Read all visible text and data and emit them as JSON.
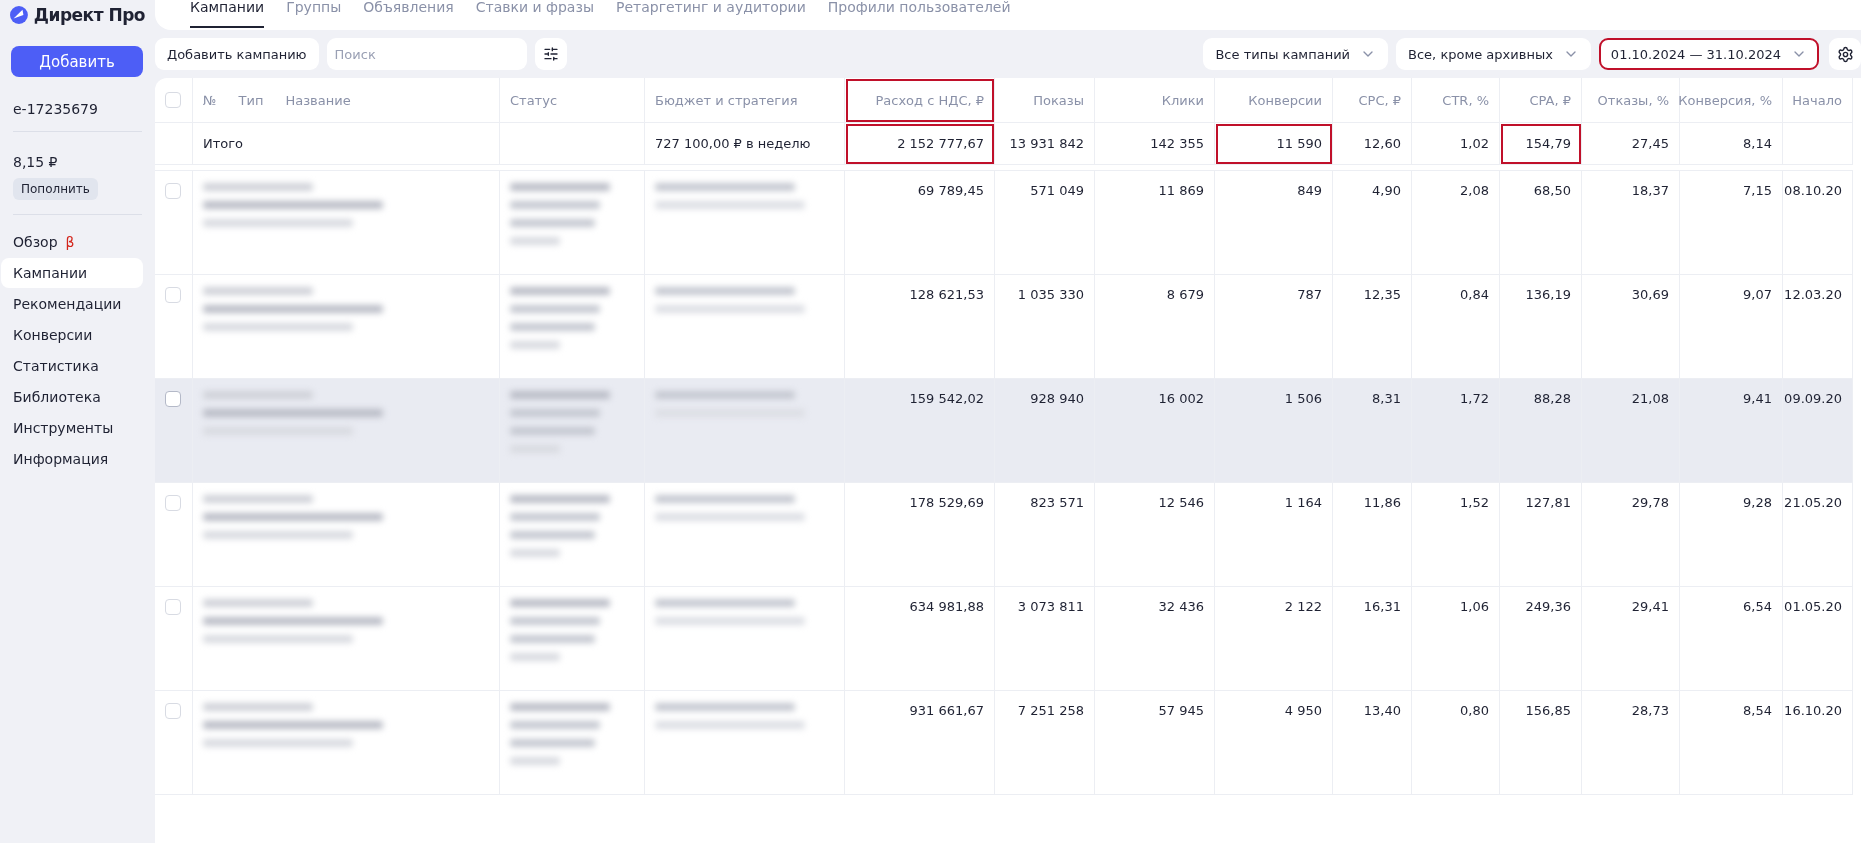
{
  "sidebar": {
    "logo": "Директ Про",
    "add_button": "Добавить",
    "account": "e-17235679",
    "balance": "8,15 ₽",
    "topup_button": "Пополнить",
    "nav": [
      {
        "label": "Обзор",
        "badge": "β",
        "selected": false
      },
      {
        "label": "Кампании",
        "selected": true
      },
      {
        "label": "Рекомендации",
        "selected": false
      },
      {
        "label": "Конверсии",
        "selected": false
      },
      {
        "label": "Статистика",
        "selected": false
      },
      {
        "label": "Библиотека",
        "selected": false
      },
      {
        "label": "Инструменты",
        "selected": false
      },
      {
        "label": "Информация",
        "selected": false
      }
    ]
  },
  "tabs": [
    {
      "label": "Кампании",
      "selected": true
    },
    {
      "label": "Группы",
      "selected": false
    },
    {
      "label": "Объявления",
      "selected": false
    },
    {
      "label": "Ставки и фразы",
      "selected": false
    },
    {
      "label": "Ретаргетинг и аудитории",
      "selected": false
    },
    {
      "label": "Профили пользователей",
      "selected": false
    }
  ],
  "toolbar": {
    "add_campaign": "Добавить кампанию",
    "search": {
      "placeholder": "Поиск"
    },
    "filters": [
      {
        "label": "Все типы кампаний",
        "highlighted": false
      },
      {
        "label": "Все, кроме архивных",
        "highlighted": false
      },
      {
        "label": "01.10.2024 — 31.10.2024",
        "highlighted": true
      }
    ]
  },
  "table": {
    "select_all": {
      "checked": false
    },
    "name_header": [
      "№",
      "Тип",
      "Название"
    ],
    "columns": [
      {
        "label": "Статус",
        "highlighted": false
      },
      {
        "label": "Бюджет и стратегия",
        "highlighted": false
      },
      {
        "label": "Расход с НДС, ₽",
        "highlighted": true
      },
      {
        "label": "Показы",
        "highlighted": false
      },
      {
        "label": "Клики",
        "highlighted": false
      },
      {
        "label": "Конверсии",
        "highlighted": false
      },
      {
        "label": "CPC, ₽",
        "highlighted": false
      },
      {
        "label": "CTR, %",
        "highlighted": false
      },
      {
        "label": "CPA, ₽",
        "highlighted": false
      },
      {
        "label": "Отказы, %",
        "highlighted": false
      },
      {
        "label": "Конверсия, %",
        "highlighted": false
      },
      {
        "label": "Начало",
        "highlighted": false
      }
    ],
    "summary": {
      "label": "Итого",
      "budget": "727 100,00 ₽ в неделю",
      "cells": [
        {
          "value": "2 152 777,67",
          "highlighted": true
        },
        {
          "value": "13 931 842",
          "highlighted": false
        },
        {
          "value": "142 355",
          "highlighted": false
        },
        {
          "value": "11 590",
          "highlighted": true
        },
        {
          "value": "12,60",
          "highlighted": false
        },
        {
          "value": "1,02",
          "highlighted": false
        },
        {
          "value": "154,79",
          "highlighted": true
        },
        {
          "value": "27,45",
          "highlighted": false
        },
        {
          "value": "8,14",
          "highlighted": false
        }
      ]
    },
    "rows": [
      {
        "checked": false,
        "hovered": false,
        "values": [
          "69 789,45",
          "571 049",
          "11 869",
          "849",
          "4,90",
          "2,08",
          "68,50",
          "18,37",
          "7,15",
          "08.10.20"
        ]
      },
      {
        "checked": false,
        "hovered": false,
        "values": [
          "128 621,53",
          "1 035 330",
          "8 679",
          "787",
          "12,35",
          "0,84",
          "136,19",
          "30,69",
          "9,07",
          "12.03.20"
        ]
      },
      {
        "checked": false,
        "hovered": true,
        "values": [
          "159 542,02",
          "928 940",
          "16 002",
          "1 506",
          "8,31",
          "1,72",
          "88,28",
          "21,08",
          "9,41",
          "09.09.20"
        ]
      },
      {
        "checked": false,
        "hovered": false,
        "values": [
          "178 529,69",
          "823 571",
          "12 546",
          "1 164",
          "11,86",
          "1,52",
          "127,81",
          "29,78",
          "9,28",
          "21.05.20"
        ]
      },
      {
        "checked": false,
        "hovered": false,
        "values": [
          "634 981,88",
          "3 073 811",
          "32 436",
          "2 122",
          "16,31",
          "1,06",
          "249,36",
          "29,41",
          "6,54",
          "01.05.20"
        ]
      },
      {
        "checked": false,
        "hovered": false,
        "values": [
          "931 661,67",
          "7 251 258",
          "57 945",
          "4 950",
          "13,40",
          "0,80",
          "156,85",
          "28,73",
          "8,54",
          "16.10.20"
        ]
      }
    ]
  }
}
